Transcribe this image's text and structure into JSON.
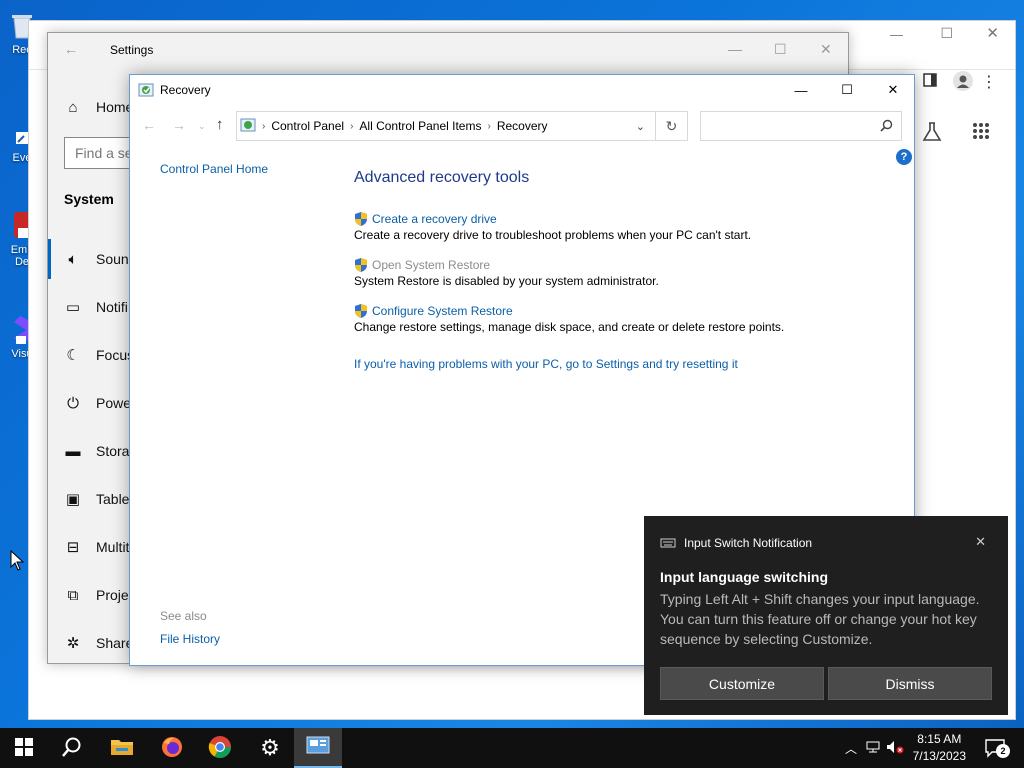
{
  "desktop": {
    "icons": [
      {
        "label": "Rec",
        "name": "recycle-bin-icon"
      },
      {
        "label": "Eve",
        "name": "desktop-shortcut-eve-icon"
      },
      {
        "label": "Emb",
        "label2": "De",
        "name": "desktop-shortcut-emb-icon"
      },
      {
        "label": "Visu",
        "name": "visual-studio-shortcut-icon"
      }
    ]
  },
  "settings": {
    "title": "Settings",
    "home_label": "Home",
    "search_placeholder": "Find a se",
    "section_heading": "System",
    "nav_items": [
      {
        "label": "Sound",
        "icon": "speaker-icon"
      },
      {
        "label": "Notifi",
        "icon": "notification-icon"
      },
      {
        "label": "Focus",
        "icon": "moon-icon"
      },
      {
        "label": "Powe",
        "icon": "power-icon"
      },
      {
        "label": "Storag",
        "icon": "storage-icon"
      },
      {
        "label": "Tablet",
        "icon": "tablet-icon"
      },
      {
        "label": "Multit",
        "icon": "multitasking-icon"
      },
      {
        "label": "Projec",
        "icon": "projecting-icon"
      },
      {
        "label": "Share",
        "icon": "shared-experiences-icon"
      }
    ]
  },
  "recovery": {
    "title": "Recovery",
    "breadcrumb": [
      "Control Panel",
      "All Control Panel Items",
      "Recovery"
    ],
    "search_placeholder": "",
    "sidebar_link": "Control Panel Home",
    "see_also_label": "See also",
    "see_also_link": "File History",
    "heading": "Advanced recovery tools",
    "tasks": [
      {
        "link": "Create a recovery drive",
        "desc": "Create a recovery drive to troubleshoot problems when your PC can't start.",
        "enabled": true
      },
      {
        "link": "Open System Restore",
        "desc": "System Restore is disabled by your system administrator.",
        "enabled": false
      },
      {
        "link": "Configure System Restore",
        "desc": "Change restore settings, manage disk space, and create or delete restore points.",
        "enabled": true
      }
    ],
    "reset_link": "If you're having problems with your PC, go to Settings and try resetting it",
    "help_glyph": "?"
  },
  "notification": {
    "header": "Input Switch Notification",
    "title": "Input language switching",
    "body": "Typing Left Alt + Shift changes your input language. You can turn this feature off or change your hot key sequence by selecting Customize.",
    "customize_label": "Customize",
    "dismiss_label": "Dismiss"
  },
  "taskbar": {
    "time": "8:15 AM",
    "date": "7/13/2023",
    "notification_count": "2"
  },
  "colors": {
    "link": "#0b5fa8",
    "heading": "#1e3a8a",
    "taskbar": "#101010",
    "notification_bg": "#1f1f1f"
  }
}
